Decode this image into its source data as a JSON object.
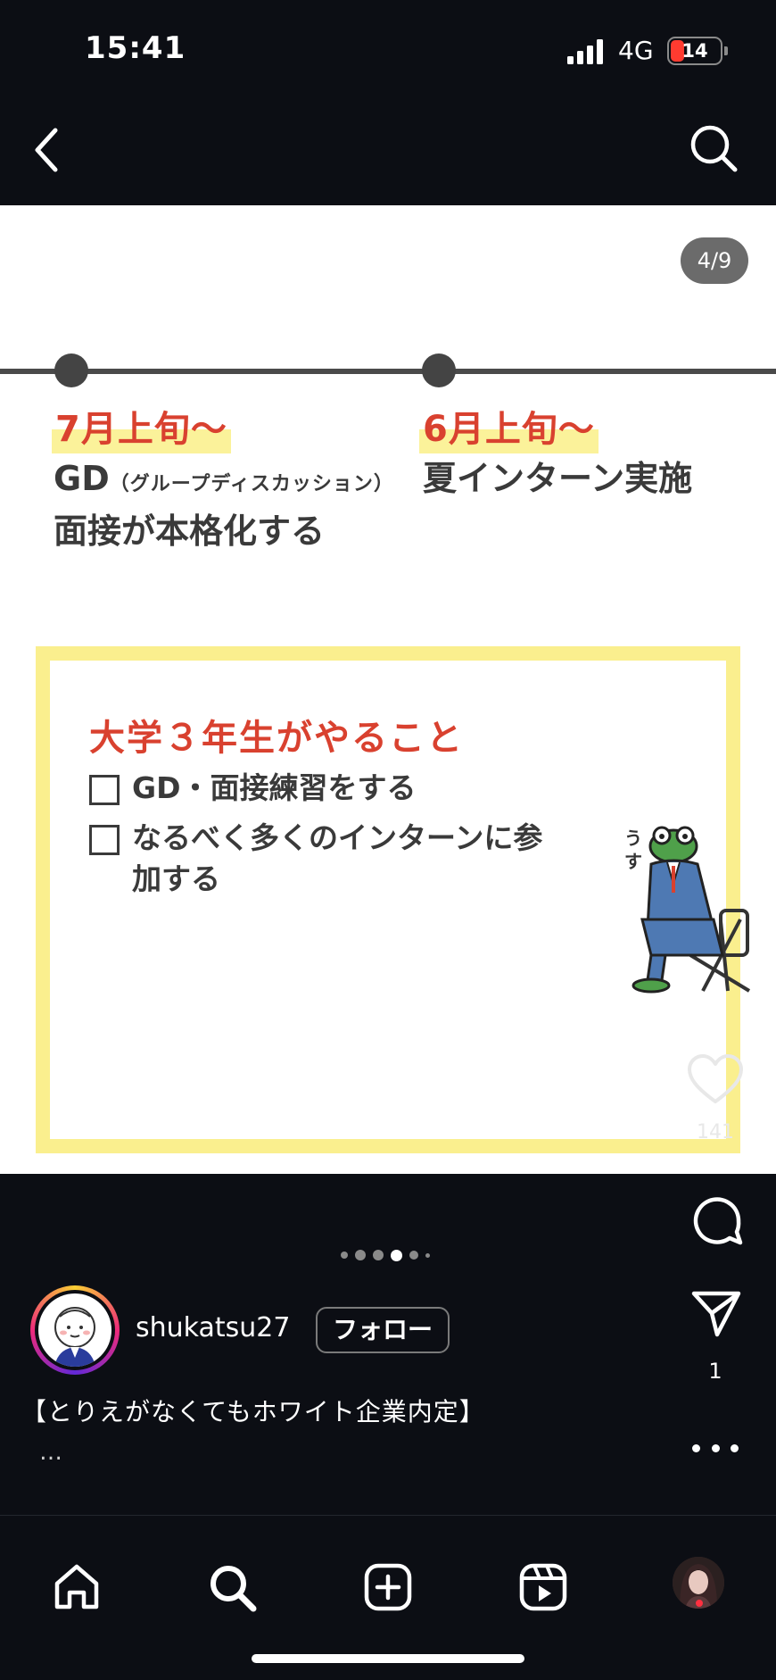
{
  "status_bar": {
    "time": "15:41",
    "network": "4G",
    "battery": "14"
  },
  "slide": {
    "counter": "4/9",
    "events": [
      {
        "date": "7月上旬〜",
        "line1": "GD",
        "note": "（グループディスカッション）",
        "line2": "面接が本格化する"
      },
      {
        "date": "6月上旬〜",
        "line1": "夏インターン実施"
      }
    ],
    "todo": {
      "title": "大学３年生がやること",
      "items": [
        "GD・面接練習をする",
        "なるべく多くのインターンに参加する"
      ]
    },
    "frog_speech": "うす"
  },
  "actions": {
    "like_count": "141",
    "share_count": "1"
  },
  "author": {
    "username": "shukatsu27",
    "follow_label": "フォロー"
  },
  "caption": {
    "text": "【とりえがなくてもホワイト企業内定】",
    "more": "…"
  },
  "carousel": {
    "total": 6,
    "active": 4
  },
  "colors": {
    "accent_red": "#d9412f",
    "highlight_yellow": "#faef8e",
    "background": "#0c0e14"
  }
}
